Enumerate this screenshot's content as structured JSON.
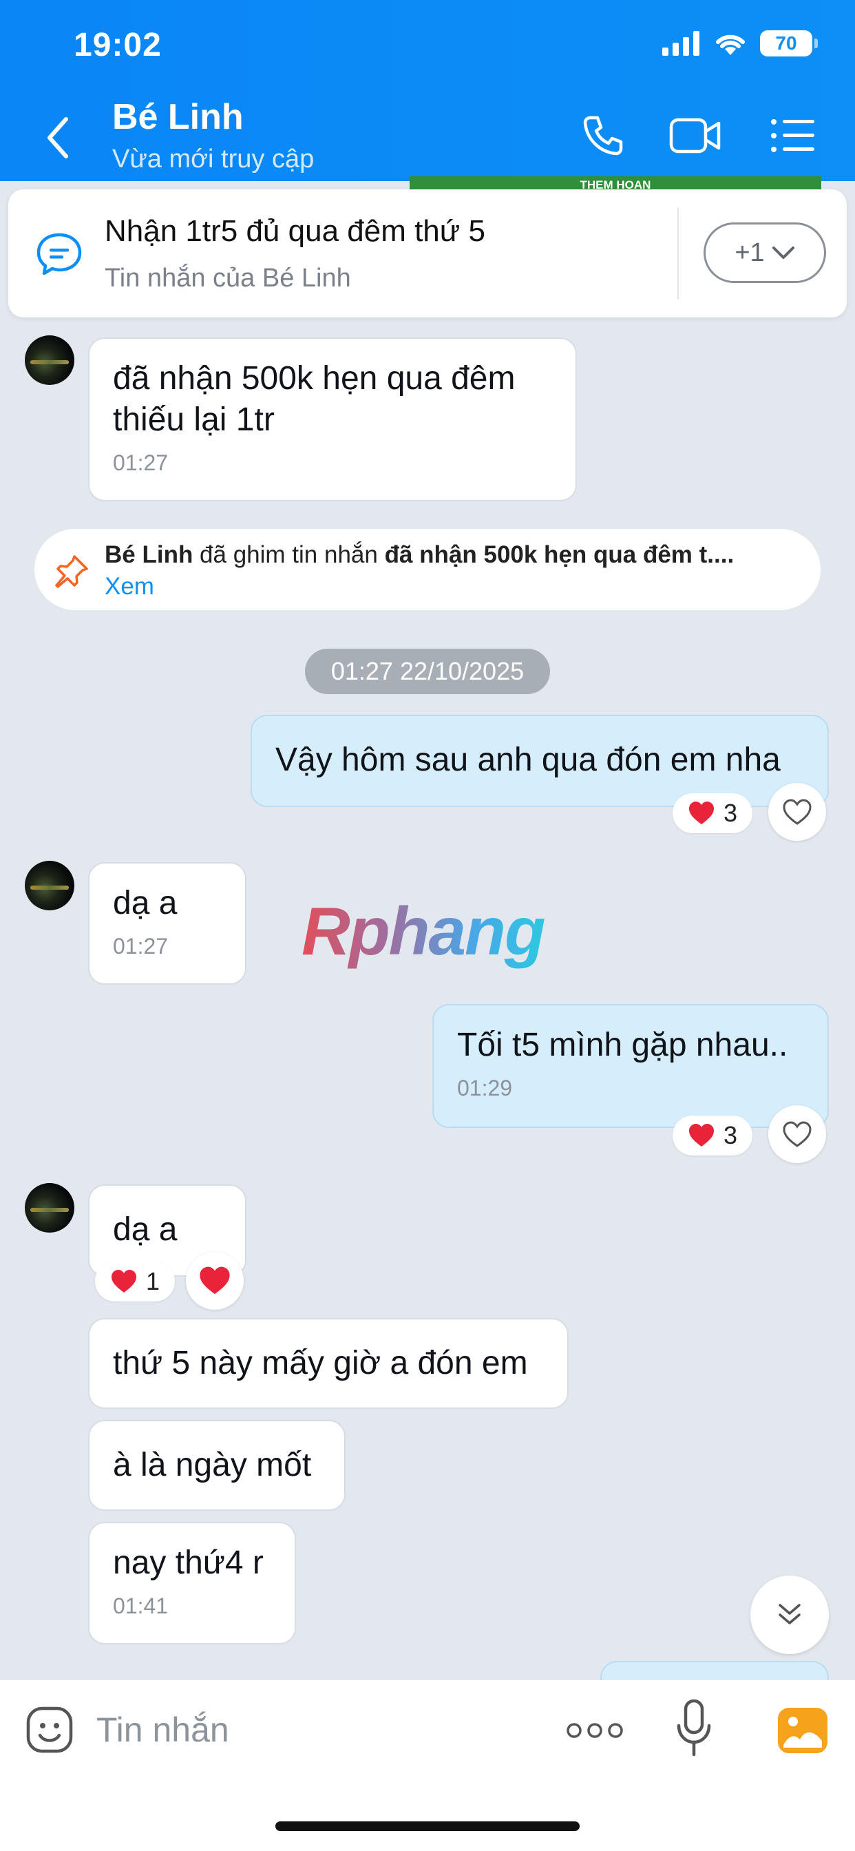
{
  "status_bar": {
    "time": "19:02",
    "battery": "70"
  },
  "header": {
    "title": "Bé Linh",
    "subtitle": "Vừa mới truy cập"
  },
  "pinned_card": {
    "peek_text": "THEM HOAN",
    "title": "Nhận 1tr5 đủ qua đêm thứ 5",
    "subtitle": "Tin nhắn của Bé Linh",
    "more_label": "+1"
  },
  "messages": [
    {
      "text": "đã nhận 500k hẹn qua đêm\nthiếu lại 1tr",
      "time": "01:27"
    }
  ],
  "pin_notice": {
    "actor": "Bé Linh",
    "action": " đã ghim tin nhắn ",
    "snippet": "đã nhận 500k hẹn qua đêm  t....",
    "link": "Xem"
  },
  "date_divider": "01:27 22/10/2025",
  "chat": {
    "m2": {
      "text": "Vậy hôm sau anh qua đón em nha",
      "reaction_count": "3"
    },
    "m3": {
      "text": "dạ a",
      "time": "01:27"
    },
    "m4": {
      "text": "Tối t5 mình gặp nhau..",
      "time": "01:29",
      "reaction_count": "3"
    },
    "m5": {
      "text": "dạ a",
      "reaction_count": "1"
    },
    "m6": {
      "text": "thứ 5 này mấy giờ a đón em"
    },
    "m7": {
      "text": "à là ngày mốt"
    },
    "m8": {
      "text": "nay thứ4 r",
      "time": "01:41"
    }
  },
  "watermark": "Rphang",
  "composer": {
    "placeholder": "Tin nhắn"
  },
  "colors": {
    "accent": "#0d8ff7",
    "outgoing_bubble": "#d6eefc",
    "background": "#e3e8ef",
    "heart": "#e8233a"
  }
}
